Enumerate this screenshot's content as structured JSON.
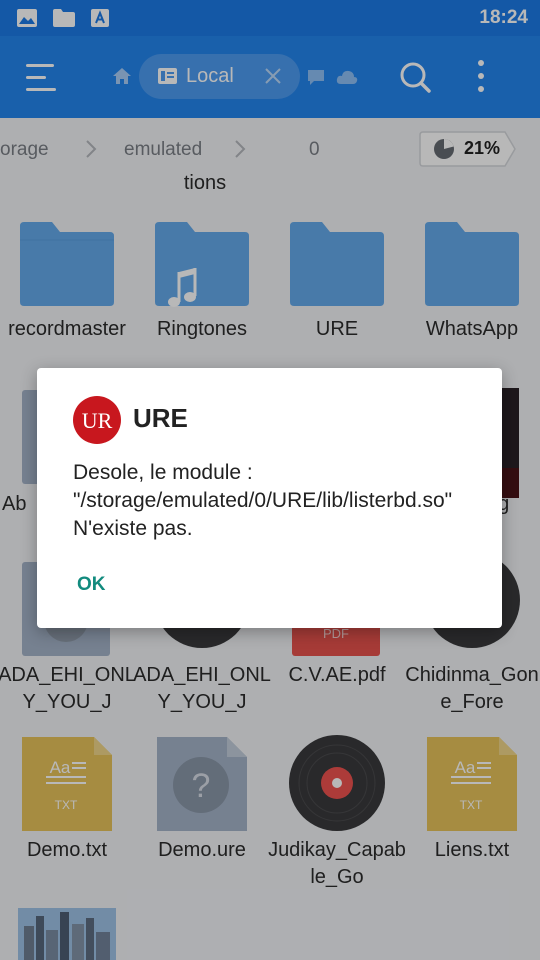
{
  "status_bar": {
    "time": "18:24",
    "icons": [
      "gallery-icon",
      "folder-icon",
      "a-square-icon"
    ]
  },
  "app_bar": {
    "tab_label": "Local",
    "icons": [
      "menu-icon",
      "home-icon",
      "close-icon",
      "chat-icon",
      "cloud-icon",
      "search-icon",
      "more-vertical-icon"
    ]
  },
  "breadcrumb": {
    "items": [
      "orage",
      "emulated",
      "0"
    ]
  },
  "storage": {
    "percent_label": "21%",
    "used_fraction": 0.21
  },
  "partial_label": "tions",
  "files": [
    {
      "name": "recordmaster"
    },
    {
      "name": "Ringtones"
    },
    {
      "name": "URE"
    },
    {
      "name": "WhatsApp"
    },
    {
      "name": "Ab"
    },
    {
      "name": "og"
    },
    {
      "name": "ADA_EHI_ONLY_YOU_J"
    },
    {
      "name": "ADA_EHI_ONLY_YOU_J"
    },
    {
      "name": "C.V.AE.pdf"
    },
    {
      "name": "Chidinma_Gone_Fore"
    },
    {
      "name": "Demo.txt"
    },
    {
      "name": "Demo.ure"
    },
    {
      "name": "Judikay_Capable_Go"
    },
    {
      "name": "Liens.txt"
    }
  ],
  "icons": {
    "pdf_text": "PDF",
    "txt_title": "Aa",
    "txt_text": "TXT",
    "unknown_text": "?"
  },
  "dialog": {
    "logo_text": "UR",
    "title": "URE",
    "message": "Desole, le module : \"/storage/emulated/0/URE/lib/listerbd.so\" N'existe pas.",
    "ok_label": "OK"
  },
  "colors": {
    "primary": "#2385ee",
    "status": "#1c7be6",
    "folder": "#64a9ea",
    "accent_ok": "#128b7e",
    "logo_red": "#c8171e"
  }
}
